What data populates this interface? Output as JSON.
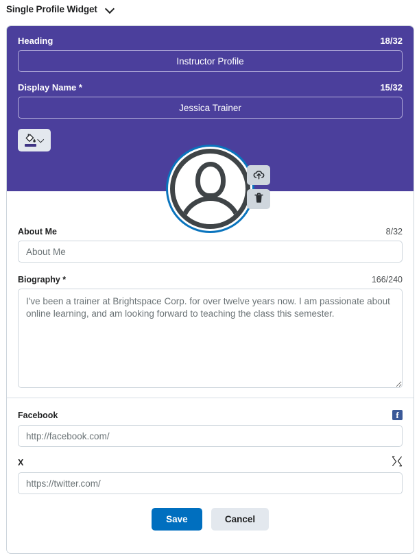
{
  "titlebar": {
    "title": "Single Profile Widget",
    "chevron_icon": "chevron-down-icon"
  },
  "header_section": {
    "background_color": "#4b3f9c",
    "heading": {
      "label": "Heading",
      "counter": "18/32",
      "value": "Instructor Profile"
    },
    "display_name": {
      "label": "Display Name *",
      "counter": "15/32",
      "value": "Jessica Trainer"
    },
    "color_picker": {
      "icon": "paint-bucket-icon",
      "chevron_icon": "chevron-down-icon",
      "swatch_color": "#3f3485"
    },
    "avatar": {
      "icon": "user-avatar-placeholder-icon",
      "ring_color": "#0a74bd",
      "upload_icon": "cloud-upload-icon",
      "delete_icon": "trash-icon"
    }
  },
  "about_section": {
    "label": "About Me",
    "counter": "8/32",
    "value": "About Me",
    "placeholder": "About Me"
  },
  "biography_section": {
    "label": "Biography *",
    "counter": "166/240",
    "value": "I've been a trainer at Brightspace Corp. for over twelve years now. I am passionate about online learning, and am looking forward to teaching the class this semester."
  },
  "social_section": {
    "facebook": {
      "label": "Facebook",
      "icon": "facebook-icon",
      "icon_glyph": "f",
      "icon_color": "#3b5998",
      "value": "http://facebook.com/",
      "placeholder": "http://facebook.com/"
    },
    "x": {
      "label": "X",
      "icon": "x-twitter-icon",
      "icon_glyph": "𝕏",
      "value": "https://twitter.com/",
      "placeholder": "https://twitter.com/"
    }
  },
  "footer": {
    "save_label": "Save",
    "cancel_label": "Cancel",
    "save_color": "#006fbf",
    "cancel_color": "#e3e8ee"
  }
}
